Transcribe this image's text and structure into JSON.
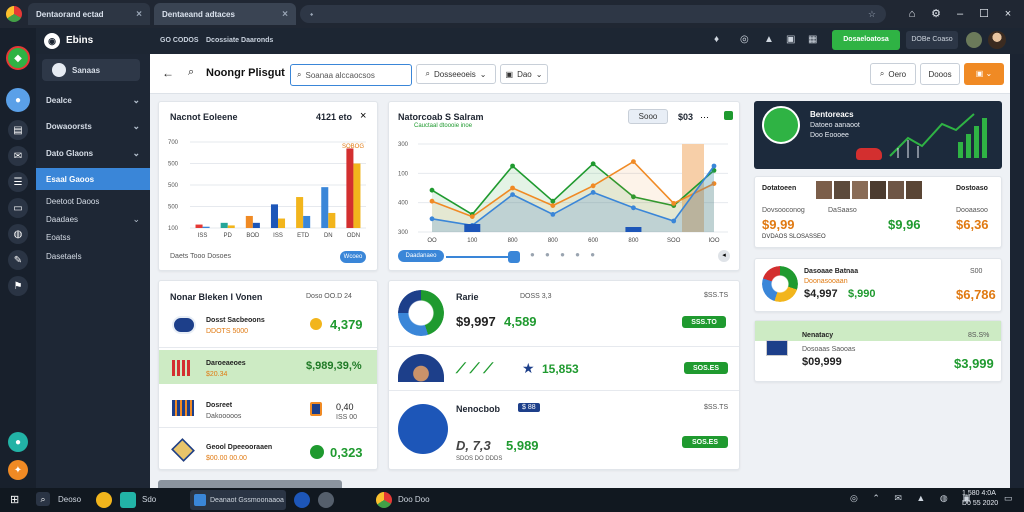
{
  "browser": {
    "tabs": [
      {
        "label": "Dentaorand ectad"
      },
      {
        "label": "Dentaeand adtaces"
      }
    ],
    "address": ""
  },
  "app": {
    "name": "Ebins",
    "header_link_1": "GO CODOS",
    "header_link_2": "Dcossiate Daaronds",
    "cta_label": "Dosaeloatosa",
    "header_text_2": "DOBe Coaso"
  },
  "sidebar": {
    "top_item": "Sanaas",
    "items": [
      {
        "label": "Dealce"
      },
      {
        "label": "Dowaoorsts"
      },
      {
        "label": "Dato Glaons"
      },
      {
        "label": "Esaal Gaoos"
      },
      {
        "label": "Deetoot Daoos"
      },
      {
        "label": "Daadaes"
      },
      {
        "label": "Eoatss"
      },
      {
        "label": "Dasetaels"
      }
    ]
  },
  "toolbar": {
    "page_title": "Noongr Plisgut",
    "search_placeholder": "Soanaa alccaocsos",
    "filter1": "Dosseeoeis",
    "filter2": "Dao",
    "right_btn1": "Oero",
    "right_btn2": "Dooos"
  },
  "card_bar": {
    "title": "Nacnot Eoleene",
    "value": "4121 eto",
    "yticks": [
      "700",
      "500",
      "500",
      "500",
      "100"
    ],
    "xticks": [
      "ISS",
      "PD",
      "BOD",
      "ISS",
      "ETD",
      "DN",
      "ODN"
    ],
    "top_label": "SOBOG",
    "footer": "Daets Tooo Dosoes",
    "footer_btn": "Wcoeo"
  },
  "card_line": {
    "title": "Natorcoab S Salram",
    "subtitle": "Cauctaal dtoooie inoe",
    "btn": "Sooo",
    "value": "$03",
    "yticks": [
      "300",
      "100",
      "400",
      "300"
    ],
    "xticks": [
      "OO",
      "100",
      "800",
      "800",
      "600",
      "800",
      "SOO",
      "IOO"
    ],
    "slider_label": "Daadanaeo"
  },
  "card_green": {
    "title": "Bentoreacs",
    "line1": "Datoeo aanaoot",
    "line2": "Doo Eoooee"
  },
  "card_people": {
    "title": "Dotatoeen",
    "sub_left": "Dovsooconog",
    "value_left": "$9,99",
    "value_left_sub": "DVDAOS SLOSASSEO",
    "mid_label": "DaSaaso",
    "mid_value": "$9,96",
    "right_title": "Dostoaso",
    "right_sub": "Dooaasoo",
    "right_value": "$6,36"
  },
  "card_list": {
    "title": "Nonar Bleken I Vonen",
    "header_value": "Doso OO.D 24",
    "rows": [
      {
        "label": "Dosst Sacbeoons",
        "sub": "DDOTS 5000",
        "value": "4,379"
      },
      {
        "label": "Daroeaeoes",
        "sub": "$20.34",
        "value": "$,989,39,%"
      },
      {
        "label": "Dosreet",
        "sub": "Dakooooos",
        "value": "0,40",
        "value_sub": "ISS 00"
      },
      {
        "label": "Geool Dpeeooraaen",
        "sub": "$00.00 00.00",
        "value": "0,323"
      }
    ]
  },
  "card_mid": {
    "r1_title": "Rarie",
    "r1_sub": "DOSS 3,3",
    "r1_value": "$9,997",
    "r1_value2": "4,589",
    "r1_right": "$SS.TS",
    "r1_pill": "SSS.TO",
    "r2_value": "15,853",
    "r2_pill": "SOS.ES",
    "r3_title": "Nenocbob",
    "r3_tag": "$ 88",
    "r3_sub": "D, 7,3",
    "r3_value": "5,989",
    "r3_right": "$SS.TS",
    "r3_pill": "SOS.ES",
    "r3_foot": "SDOS DO DDDS"
  },
  "card_pie": {
    "title": "Dasoaae Batnaa",
    "sub": "Doonasooaan",
    "value1": "$4,997",
    "value2": "$,990",
    "right_value": "$6,786",
    "right_top": "S00"
  },
  "card_bottom_right": {
    "title": "Nenatacy",
    "sub": "Dosoaas Saooas",
    "value": "$09,999",
    "right_top": "8S.S%",
    "right_value": "$3,999"
  },
  "taskbar": {
    "items": [
      "Deoso",
      "Sdo",
      "Deanaot Gssmoonaaoa",
      "Doo Doo"
    ],
    "time": "1,580 4:0A",
    "date": "D0 55 2020"
  },
  "chart_data": [
    {
      "type": "bar",
      "categories": [
        "ISS",
        "PD",
        "BOD",
        "ISS",
        "ETD",
        "DN",
        "ODN"
      ],
      "series": [
        {
          "values": [
            8,
            12,
            28,
            55,
            72,
            95,
            185
          ]
        },
        {
          "values": [
            3,
            6,
            12,
            22,
            28,
            35,
            150
          ]
        }
      ],
      "title": "Nacnot Eoleene",
      "ylim": [
        0,
        200
      ]
    },
    {
      "type": "line",
      "categories": [
        "OO",
        "100",
        "800",
        "800",
        "600",
        "800",
        "SOO",
        "IOO"
      ],
      "series": [
        {
          "values": [
            95,
            40,
            150,
            70,
            155,
            80,
            60,
            140
          ]
        },
        {
          "values": [
            70,
            35,
            100,
            60,
            105,
            160,
            65,
            110
          ]
        },
        {
          "values": [
            30,
            15,
            85,
            40,
            90,
            55,
            25,
            150
          ]
        }
      ],
      "title": "Natorcoab S Salram",
      "ylim": [
        0,
        200
      ]
    }
  ]
}
